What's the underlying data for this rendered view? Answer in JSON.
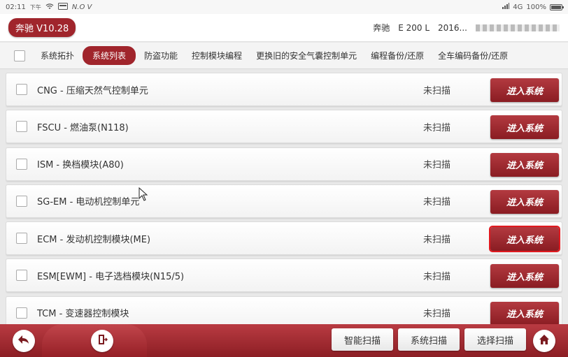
{
  "statusbar": {
    "time": "02:11",
    "ampm": "下午",
    "extra": "N.O V",
    "network": "4G",
    "battery": "100%"
  },
  "header": {
    "brand": "奔驰 V10.28",
    "make": "奔驰",
    "model": "E 200 L",
    "year": "2016..."
  },
  "tabs": [
    {
      "label": "系统拓扑"
    },
    {
      "label": "系统列表"
    },
    {
      "label": "防盗功能"
    },
    {
      "label": "控制模块编程"
    },
    {
      "label": "更换旧的安全气囊控制单元"
    },
    {
      "label": "编程备份/还原"
    },
    {
      "label": "全车编码备份/还原"
    }
  ],
  "systems": [
    {
      "name": "CNG - 压缩天然气控制单元",
      "status": "未扫描",
      "button": "进入系统"
    },
    {
      "name": "FSCU - 燃油泵(N118)",
      "status": "未扫描",
      "button": "进入系统"
    },
    {
      "name": "ISM - 换档模块(A80)",
      "status": "未扫描",
      "button": "进入系统"
    },
    {
      "name": "SG-EM - 电动机控制单元",
      "status": "未扫描",
      "button": "进入系统"
    },
    {
      "name": "ECM - 发动机控制模块(ME)",
      "status": "未扫描",
      "button": "进入系统"
    },
    {
      "name": "ESM[EWM] - 电子选档模块(N15/5)",
      "status": "未扫描",
      "button": "进入系统"
    },
    {
      "name": "TCM - 变速器控制模块",
      "status": "未扫描",
      "button": "进入系统"
    }
  ],
  "bottombar": {
    "smart_scan": "智能扫描",
    "system_scan": "系统扫描",
    "select_scan": "选择扫描"
  },
  "icons": {
    "back": "back-arrow-icon",
    "exit": "exit-door-icon",
    "home": "home-icon"
  },
  "colors": {
    "accent": "#a0252c",
    "focus": "#e0191f"
  }
}
